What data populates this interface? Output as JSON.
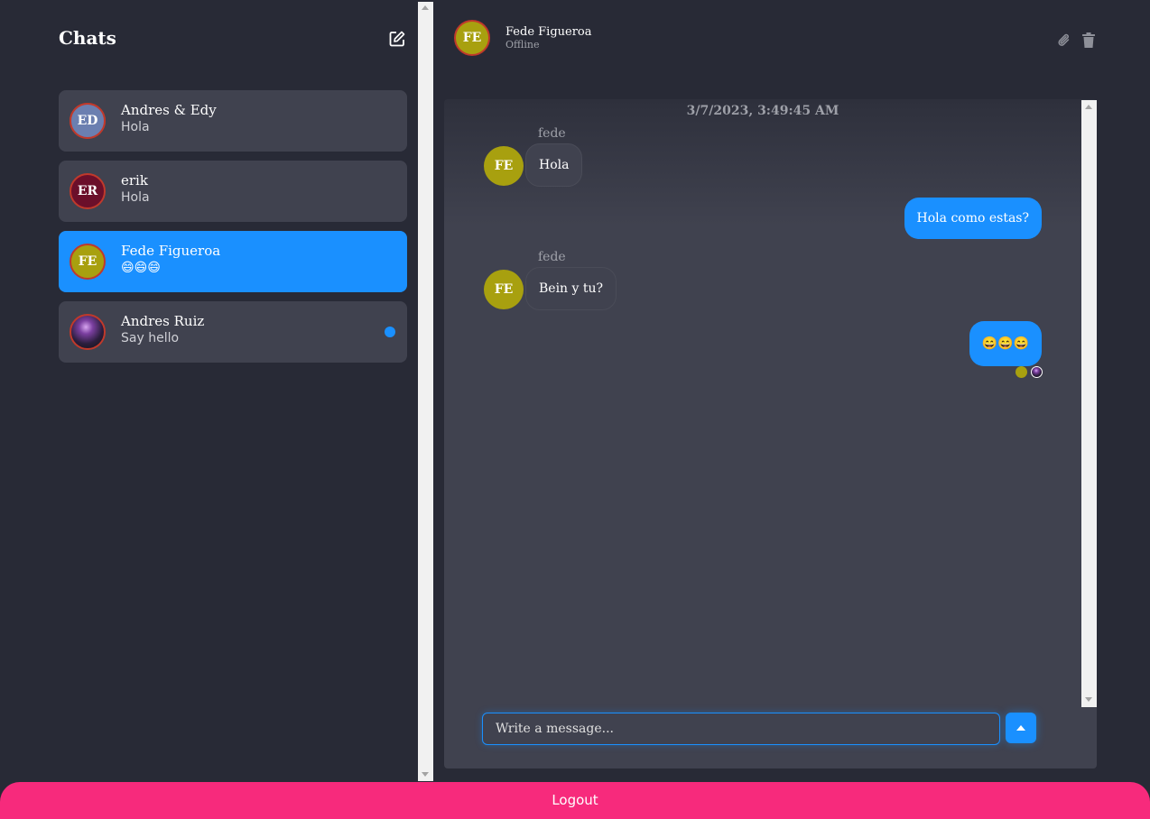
{
  "sidebar": {
    "title": "Chats",
    "chats": [
      {
        "name": "Andres & Edy",
        "preview": "Hola",
        "initials": "ED"
      },
      {
        "name": "erik",
        "preview": "Hola",
        "initials": "ER"
      },
      {
        "name": "Fede Figueroa",
        "preview": "😄😄😄",
        "initials": "FE"
      },
      {
        "name": "Andres Ruiz",
        "preview": "Say hello"
      }
    ]
  },
  "conversation": {
    "name": "Fede Figueroa",
    "status": "Offline",
    "initials": "FE",
    "timestamp": "3/7/2023, 3:49:45 AM",
    "messages": [
      {
        "sender": "fede",
        "initials": "FE",
        "text": "Hola",
        "direction": "in"
      },
      {
        "text": "Hola como estas?",
        "direction": "out"
      },
      {
        "sender": "fede",
        "initials": "FE",
        "text": "Bein y tu?",
        "direction": "in"
      },
      {
        "text": "😄😄😄",
        "direction": "out"
      }
    ],
    "input_placeholder": "Write a message..."
  },
  "logout_label": "Logout",
  "colors": {
    "background": "#282a36",
    "panel": "#40424f",
    "accent": "#1a90ff",
    "logout": "#f72a7c",
    "avatar_fede": "#a8a00f",
    "avatar_erik": "#6b0f2a"
  }
}
